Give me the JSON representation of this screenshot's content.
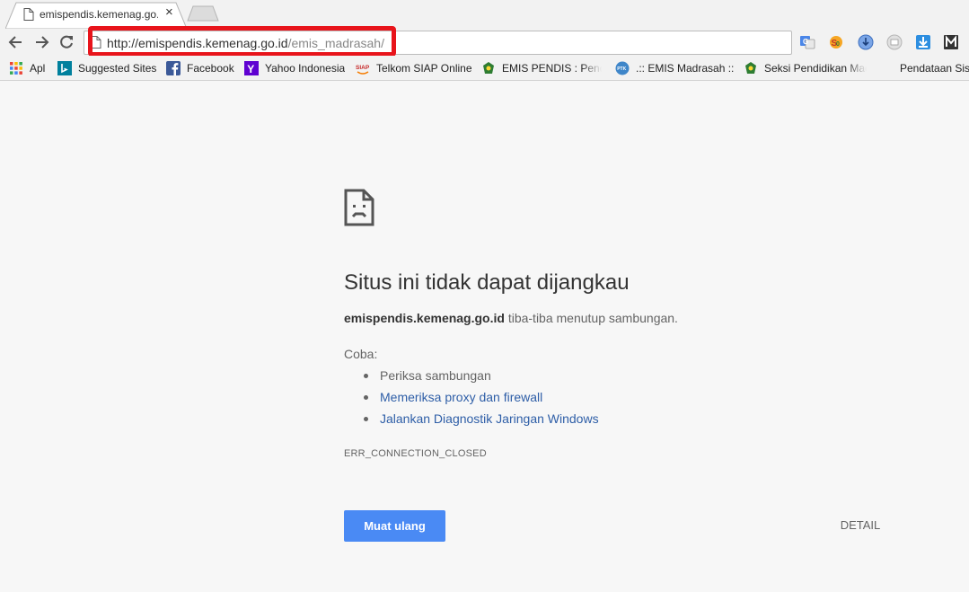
{
  "tab": {
    "title": "emispendis.kemenag.go.id",
    "close_glyph": "×"
  },
  "toolbar": {
    "url_host": "http://emispendis.kemenag.go.id",
    "url_path": "/emis_madrasah/",
    "extensions": [
      "google-translate-icon",
      "seo-quake-icon",
      "download-circle-icon",
      "window-icon",
      "download-arrow-icon",
      "m-extension-icon"
    ]
  },
  "bookmarks": [
    {
      "label": "Apl",
      "icon": "apps-grid-icon"
    },
    {
      "label": "Suggested Sites",
      "icon": "bing-icon"
    },
    {
      "label": "Facebook",
      "icon": "facebook-icon"
    },
    {
      "label": "Yahoo Indonesia",
      "icon": "yahoo-icon"
    },
    {
      "label": "Telkom SIAP Online",
      "icon": "siap-icon"
    },
    {
      "label": "EMIS PENDIS : Penda",
      "icon": "kemenag-icon"
    },
    {
      "label": ".:: EMIS Madrasah ::.",
      "icon": "ptk-icon"
    },
    {
      "label": "Seksi Pendidikan Mad",
      "icon": "kemenag-icon"
    },
    {
      "label": "Pendataan Sisw",
      "icon": ""
    }
  ],
  "error": {
    "title": "Situs ini tidak dapat dijangkau",
    "host": "emispendis.kemenag.go.id",
    "desc_rest": " tiba-tiba menutup sambungan.",
    "try_label": "Coba:",
    "suggestions": [
      "Periksa sambungan",
      "Memeriksa proxy dan firewall",
      "Jalankan Diagnostik Jaringan Windows"
    ],
    "code": "ERR_CONNECTION_CLOSED",
    "reload_label": "Muat ulang",
    "detail_label": "DETAIL"
  },
  "colors": {
    "highlight": "#e8141b",
    "button_blue": "#4a8af4",
    "link_blue": "#2e5ea7"
  }
}
